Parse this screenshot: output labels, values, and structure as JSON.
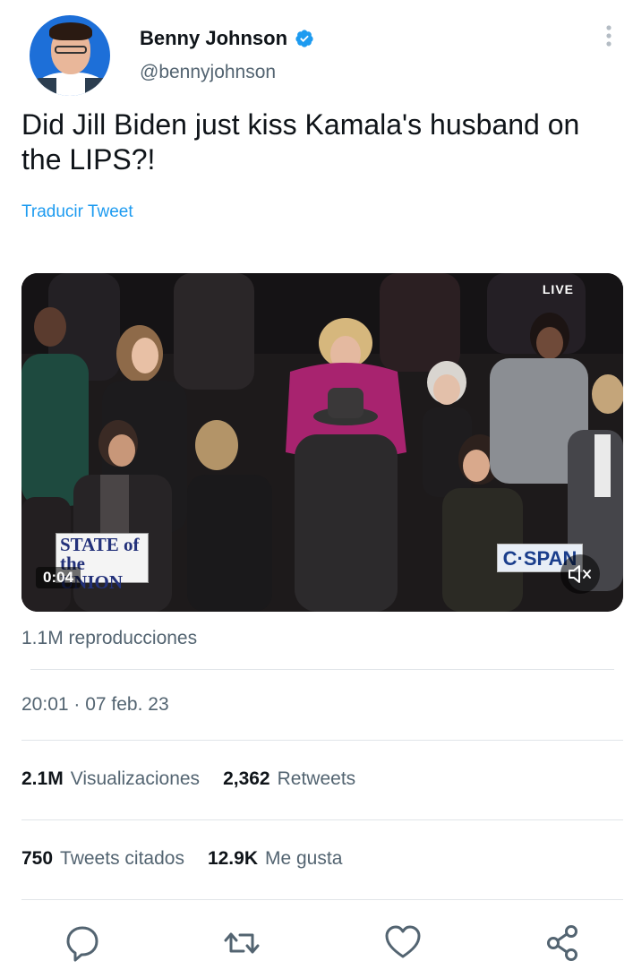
{
  "author": {
    "display_name": "Benny Johnson",
    "handle": "@bennyjohnson",
    "verified_icon": "verified-badge-icon",
    "avatar": "profile-photo"
  },
  "tweet": {
    "text": "Did Jill Biden just kiss Kamala's husband on the LIPS?!",
    "translate_label": "Traducir Tweet"
  },
  "video": {
    "live_label": "LIVE",
    "sotu_label": "STATE of the UNION",
    "network_label": "C·SPAN",
    "time": "0:04",
    "mute_icon": "speaker-muted-icon"
  },
  "views_label": "1.1M reproducciones",
  "timestamp": "20:01 · 07 feb. 23",
  "stats": {
    "visualizaciones": {
      "value": "2.1M",
      "label": "Visualizaciones"
    },
    "retweets": {
      "value": "2,362",
      "label": "Retweets"
    },
    "quotes": {
      "value": "750",
      "label": "Tweets citados"
    },
    "likes": {
      "value": "12.9K",
      "label": "Me gusta"
    }
  },
  "actions": [
    "reply-icon",
    "retweet-icon",
    "like-icon",
    "share-icon"
  ],
  "colors": {
    "accent": "#1d9bf0",
    "text": "#0f1419",
    "muted": "#536471"
  }
}
